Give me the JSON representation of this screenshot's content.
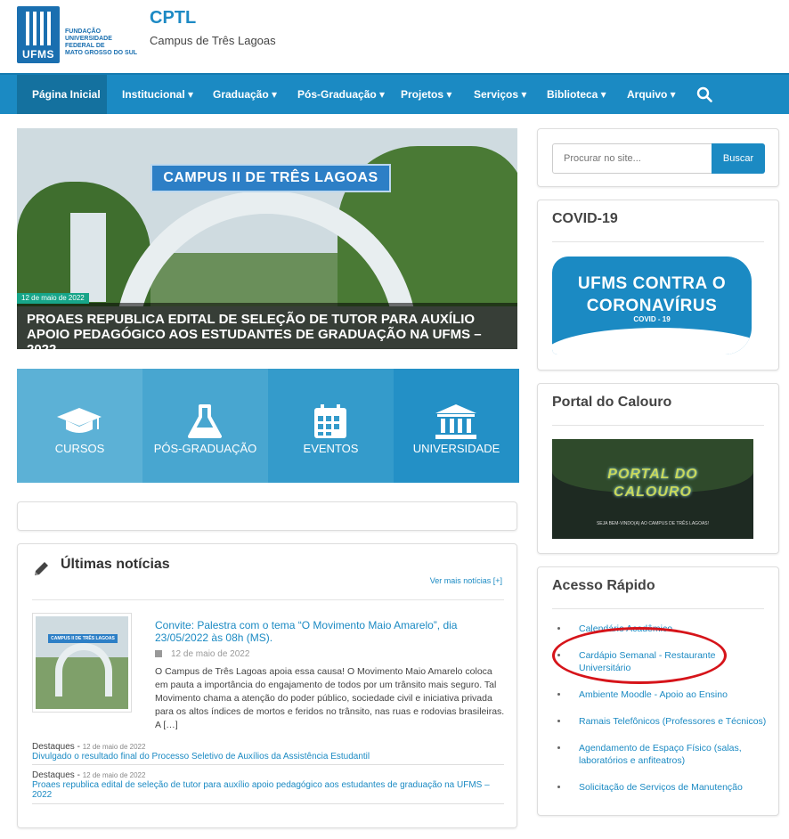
{
  "header": {
    "logo_abbr": "UFMS",
    "logo_text_lines": [
      "FUNDAÇÃO",
      "UNIVERSIDADE",
      "FEDERAL DE",
      "MATO GROSSO DO SUL"
    ],
    "site_title": "CPTL",
    "site_subtitle": "Campus de Três Lagoas"
  },
  "nav": {
    "items": [
      {
        "label": "Página Inicial"
      },
      {
        "label": "Institucional ▾"
      },
      {
        "label": "Graduação ▾"
      },
      {
        "label": "Pós-Graduação ▾"
      },
      {
        "label": "Projetos ▾"
      },
      {
        "label": "Serviços ▾"
      },
      {
        "label": "Biblioteca ▾"
      },
      {
        "label": "Arquivo ▾"
      }
    ],
    "search_icon": "search-icon"
  },
  "hero": {
    "sign_text": "CAMPUS II DE TRÊS LAGOAS",
    "date": "12 de maio de 2022",
    "title": "PROAES REPUBLICA EDITAL DE SELEÇÃO DE TUTOR PARA AUXÍLIO APOIO PEDAGÓGICO AOS ESTUDANTES DE GRADUAÇÃO NA UFMS – 2022"
  },
  "tiles": [
    {
      "label": "CURSOS",
      "icon": "graduation-cap-icon",
      "color": "#5cb1d6"
    },
    {
      "label": "PÓS-GRADUAÇÃO",
      "icon": "flask-icon",
      "color": "#48a6d0"
    },
    {
      "label": "EVENTOS",
      "icon": "calendar-icon",
      "color": "#349bcb"
    },
    {
      "label": "UNIVERSIDADE",
      "icon": "building-icon",
      "color": "#2390c6"
    }
  ],
  "news": {
    "title": "Últimas notícias",
    "more_link": "Ver mais notícias [+]",
    "featured": {
      "thumb_sign": "CAMPUS II DE TRÊS LAGOAS",
      "title": "Convite: Palestra com o tema “O Movimento Maio Amarelo”, dia 23/05/2022 às 08h (MS).",
      "date": "12 de maio de 2022",
      "text": "O Campus de Três Lagoas apoia essa causa! O Movimento Maio Amarelo coloca em pauta a importância do engajamento de todos por um trânsito mais seguro. Tal Movimento chama a atenção do poder público, sociedade civil e iniciativa privada para os altos índices de mortos e feridos no trânsito, nas ruas e rodovias brasileiras. A […]"
    },
    "items": [
      {
        "category": "Destaques -",
        "date": "12 de maio de 2022",
        "title": "Divulgado o resultado final do Processo Seletivo de Auxílios da Assistência Estudantil"
      },
      {
        "category": "Destaques -",
        "date": "12 de maio de 2022",
        "title": "Proaes republica edital de seleção de tutor para auxílio apoio pedagógico aos estudantes de graduação na UFMS – 2022"
      }
    ]
  },
  "sidebar": {
    "search": {
      "placeholder": "Procurar no site...",
      "button": "Buscar"
    },
    "covid": {
      "title": "COVID-19",
      "banner_line1": "UFMS CONTRA O",
      "banner_line2": "CORONAVÍRUS",
      "banner_sub": "COVID - 19"
    },
    "calouro": {
      "title": "Portal do Calouro",
      "image_line1": "PORTAL DO",
      "image_line2": "CALOURO",
      "image_sub": "SEJA BEM-VINDO(A) AO CAMPUS DE TRÊS LAGOAS!"
    },
    "quick": {
      "title": "Acesso Rápido",
      "items": [
        "Calendário Acadêmico",
        "Cardápio Semanal - Restaurante Universitário",
        "Ambiente Moodle - Apoio ao Ensino",
        "Ramais Telefônicos (Professores e Técnicos)",
        "Agendamento de Espaço Físico (salas, laboratórios e anfiteatros)",
        "Solicitação de Serviços de Manutenção"
      ]
    }
  },
  "colors": {
    "primary": "#1b8ac3",
    "nav_active": "#14719f",
    "highlight_oval": "#d6141a"
  }
}
